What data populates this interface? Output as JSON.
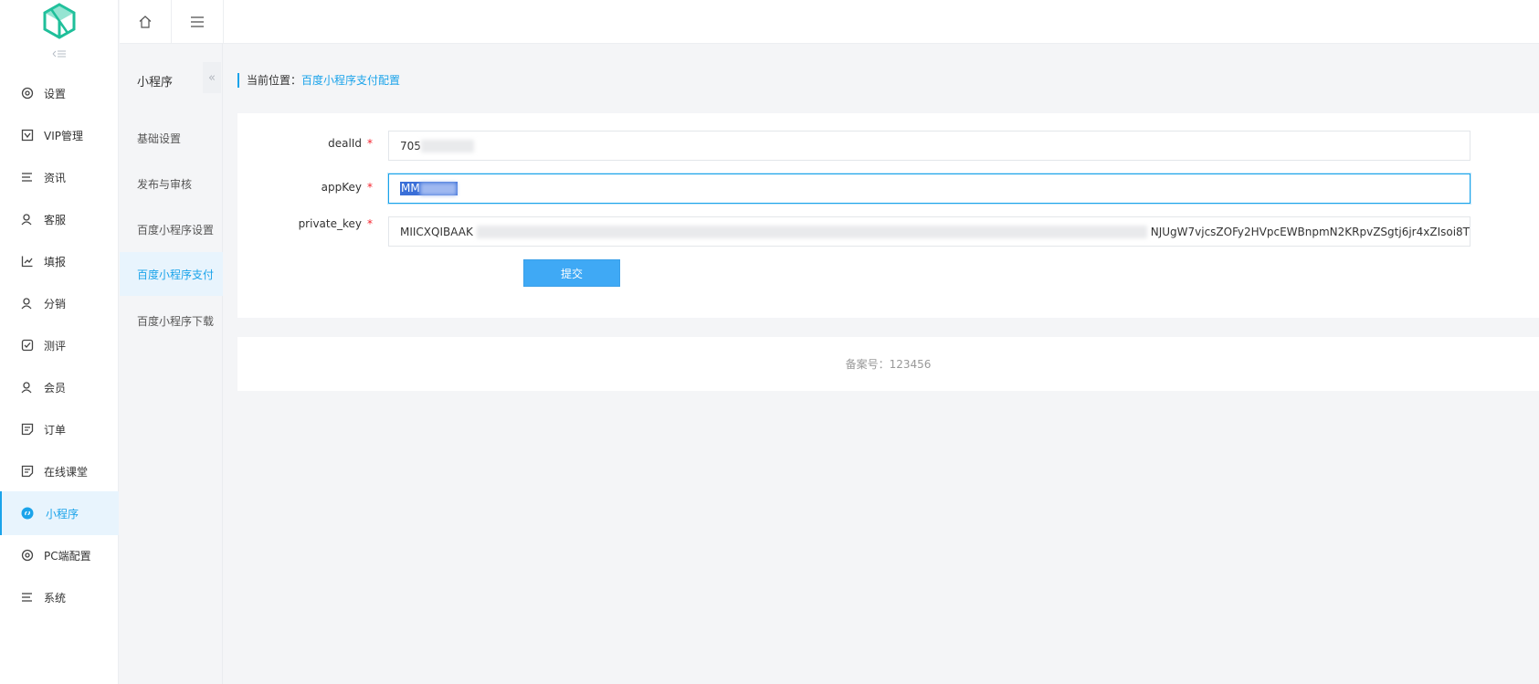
{
  "sidebar": {
    "items": [
      {
        "label": "设置",
        "icon": "gear-icon"
      },
      {
        "label": "VIP管理",
        "icon": "vip-icon"
      },
      {
        "label": "资讯",
        "icon": "list-icon"
      },
      {
        "label": "客服",
        "icon": "user-icon"
      },
      {
        "label": "填报",
        "icon": "chart-icon"
      },
      {
        "label": "分销",
        "icon": "user-icon"
      },
      {
        "label": "测评",
        "icon": "check-icon"
      },
      {
        "label": "会员",
        "icon": "user-icon"
      },
      {
        "label": "订单",
        "icon": "document-icon"
      },
      {
        "label": "在线课堂",
        "icon": "document-icon"
      },
      {
        "label": "小程序",
        "icon": "miniapp-icon",
        "active": true
      },
      {
        "label": "PC端配置",
        "icon": "gear-icon"
      },
      {
        "label": "系统",
        "icon": "list-icon"
      }
    ]
  },
  "subnav": {
    "title": "小程序",
    "collapse_glyph": "«",
    "items": [
      "基础设置",
      "发布与审核",
      "百度小程序设置",
      "百度小程序支付",
      "百度小程序下载"
    ],
    "active_index": 3
  },
  "topbar": {
    "home_icon": "home-icon",
    "menu_icon": "hamburger-icon"
  },
  "breadcrumb": {
    "prefix": "当前位置：",
    "current": "百度小程序支付配置"
  },
  "form": {
    "required_mark": "*",
    "fields": [
      {
        "label": "dealId",
        "value_visible": "705"
      },
      {
        "label": "appKey",
        "value_visible": "MM"
      },
      {
        "label": "private_key",
        "value_visible_start": "MIICXQIBAAK",
        "value_visible_end": "NJUgW7vjcsZOFy2HVpcEWBnpmN2KRpvZSgtj6jr4xZIsoi8T"
      }
    ],
    "submit_label": "提交"
  },
  "footer": {
    "text": "备案号：123456"
  },
  "colors": {
    "accent": "#1aa3ea",
    "button": "#3fa9f5",
    "logo": "#1fbf9a",
    "required": "#f5222d"
  }
}
